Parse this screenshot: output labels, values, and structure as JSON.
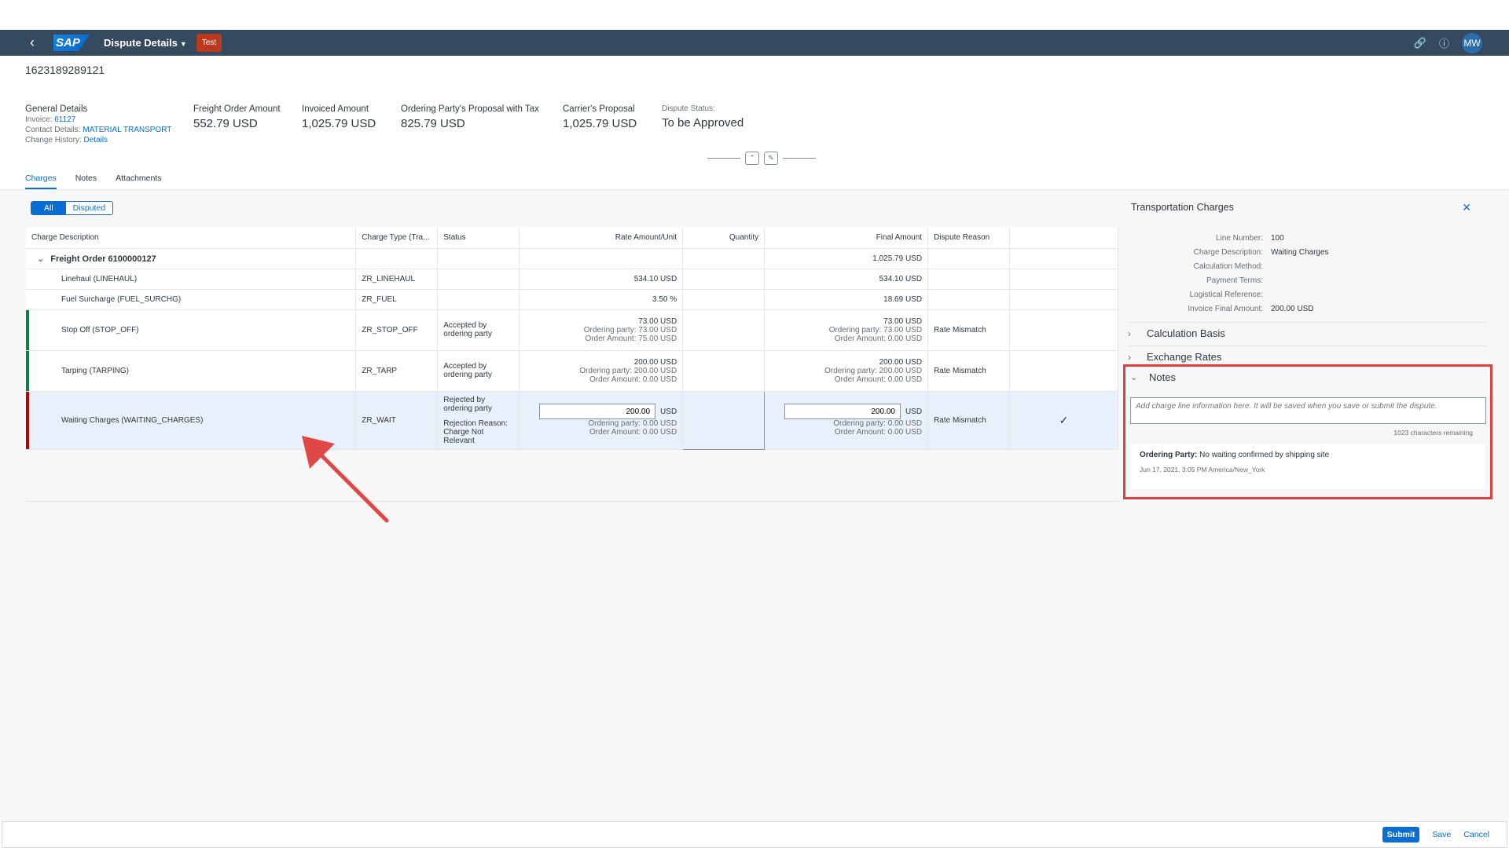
{
  "shell": {
    "app_title": "Dispute Details",
    "env_badge": "Test",
    "logo": "SAP",
    "avatar": "MW",
    "icons": [
      "back-icon",
      "link-icon",
      "help-icon"
    ]
  },
  "header": {
    "object_id": "1623189289121",
    "general": {
      "label": "General Details",
      "invoice_label": "Invoice:",
      "invoice": "61127",
      "contact_label": "Contact Details:",
      "contact": "MATERIAL TRANSPORT",
      "history_label": "Change History:",
      "history": "Details"
    },
    "kpis": [
      {
        "label": "Freight Order Amount",
        "value": "552.79 USD"
      },
      {
        "label": "Invoiced Amount",
        "value": "1,025.79 USD"
      },
      {
        "label": "Ordering Party's Proposal with Tax",
        "value": "825.79 USD"
      },
      {
        "label": "Carrier's Proposal",
        "value": "1,025.79 USD"
      }
    ],
    "status": {
      "label": "Dispute Status:",
      "value": "To be Approved"
    }
  },
  "tabs": [
    "Charges",
    "Notes",
    "Attachments"
  ],
  "filter": {
    "all": "All",
    "disputed": "Disputed"
  },
  "table": {
    "columns": [
      "Charge Description",
      "Charge Type (Tra...",
      "Status",
      "Rate Amount/Unit",
      "Quantity",
      "Final Amount",
      "Dispute Reason"
    ],
    "group": {
      "label": "Freight Order 6100000127",
      "final": "1,025.79 USD"
    },
    "rows": [
      {
        "desc": "Linehaul (LINEHAUL)",
        "type": "ZR_LINEHAUL",
        "rate": "534.10 USD",
        "final": "534.10 USD"
      },
      {
        "desc": "Fuel Surcharge (FUEL_SURCHG)",
        "type": "ZR_FUEL",
        "rate": "3.50 %",
        "final": "18.69 USD"
      },
      {
        "desc": "Stop Off (STOP_OFF)",
        "type": "ZR_STOP_OFF",
        "status": "Accepted by ordering party",
        "rate": "73.00 USD",
        "rate_op": "Ordering party: 73.00 USD",
        "rate_oa": "Order Amount: 75.00 USD",
        "final": "73.00 USD",
        "final_op": "Ordering party: 73.00 USD",
        "final_oa": "Order Amount: 0.00 USD",
        "reason": "Rate Mismatch"
      },
      {
        "desc": "Tarping (TARPING)",
        "type": "ZR_TARP",
        "status": "Accepted by ordering party",
        "rate": "200.00 USD",
        "rate_op": "Ordering party: 200.00 USD",
        "rate_oa": "Order Amount: 0.00 USD",
        "final": "200.00 USD",
        "final_op": "Ordering party: 200.00 USD",
        "final_oa": "Order Amount: 0.00 USD",
        "reason": "Rate Mismatch"
      },
      {
        "desc": "Waiting Charges (WAITING_CHARGES)",
        "type": "ZR_WAIT",
        "status": "Rejected by ordering party",
        "rej_label": "Rejection Reason:",
        "rej": "Charge Not Relevant",
        "rate_input": "200.00",
        "currency": "USD",
        "rate_op": "Ordering party: 0.00 USD",
        "rate_oa": "Order Amount: 0.00 USD",
        "final_input": "200.00",
        "final_op": "Ordering party: 0.00 USD",
        "final_oa": "Order Amount: 0.00 USD",
        "reason": "Rate Mismatch",
        "check": "✓"
      }
    ]
  },
  "side": {
    "title": "Transportation Charges",
    "fields": [
      {
        "k": "Line Number:",
        "v": "100"
      },
      {
        "k": "Charge Description:",
        "v": "Waiting Charges"
      },
      {
        "k": "Calculation Method:",
        "v": ""
      },
      {
        "k": "Payment Terms:",
        "v": ""
      },
      {
        "k": "Logistical Reference:",
        "v": ""
      },
      {
        "k": "Invoice Final Amount:",
        "v": "200.00 USD"
      }
    ],
    "panels": {
      "calc": "Calculation Basis",
      "exch": "Exchange Rates",
      "notes": "Notes"
    },
    "notes_placeholder": "Add charge line information here. It will be saved when you save or submit the dispute.",
    "remaining": "1023 characters remaining",
    "note": {
      "who": "Ordering Party:",
      "text": " No waiting confirmed by shipping site",
      "ts": "Jun 17, 2021, 3:05 PM America/New_York"
    }
  },
  "footer": {
    "submit": "Submit",
    "save": "Save",
    "cancel": "Cancel"
  },
  "colors": {
    "shell": "#354a5f",
    "accent": "#0a6ed1",
    "highlight": "#e03f3f",
    "positive": "#107e3e",
    "negative": "#bb0000"
  }
}
